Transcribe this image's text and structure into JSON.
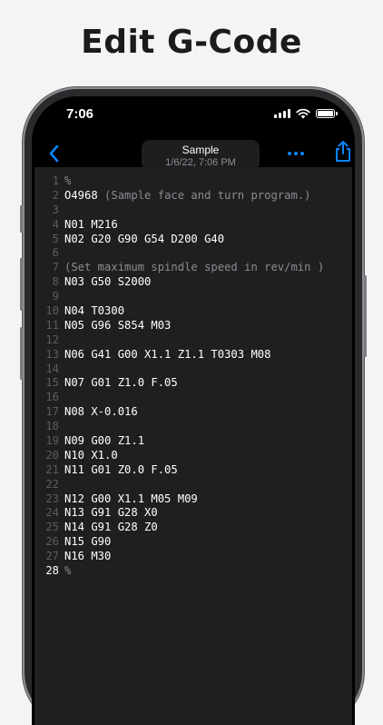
{
  "headline": "Edit G-Code",
  "status_bar": {
    "time": "7:06"
  },
  "nav": {
    "title": "Sample",
    "subtitle": "1/6/22, 7:06 PM",
    "back_icon": "chevron-left-icon",
    "more_icon": "ellipsis-icon",
    "share_icon": "share-icon"
  },
  "colors": {
    "accent": "#0a84ff",
    "editor_bg": "#1f1f21",
    "line_number": "#5d5d61",
    "comment": "#8c8c90"
  },
  "editor": {
    "current_line": 28,
    "lines": [
      {
        "num": "1",
        "code": "%",
        "comment": ""
      },
      {
        "num": "2",
        "code": "O4968 ",
        "comment": "(Sample face and turn program.)"
      },
      {
        "num": "3",
        "code": "",
        "comment": ""
      },
      {
        "num": "4",
        "code": "N01 M216",
        "comment": ""
      },
      {
        "num": "5",
        "code": "N02 G20 G90 G54 D200 G40",
        "comment": ""
      },
      {
        "num": "6",
        "code": "",
        "comment": ""
      },
      {
        "num": "7",
        "code": "",
        "comment": "(Set maximum spindle speed in rev/min )"
      },
      {
        "num": "8",
        "code": "N03 G50 S2000",
        "comment": ""
      },
      {
        "num": "9",
        "code": "",
        "comment": ""
      },
      {
        "num": "10",
        "code": "N04 T0300",
        "comment": ""
      },
      {
        "num": "11",
        "code": "N05 G96 S854 M03",
        "comment": ""
      },
      {
        "num": "12",
        "code": "",
        "comment": ""
      },
      {
        "num": "13",
        "code": "N06 G41 G00 X1.1 Z1.1 T0303 M08",
        "comment": ""
      },
      {
        "num": "14",
        "code": "",
        "comment": ""
      },
      {
        "num": "15",
        "code": "N07 G01 Z1.0 F.05",
        "comment": ""
      },
      {
        "num": "16",
        "code": "",
        "comment": ""
      },
      {
        "num": "17",
        "code": "N08 X-0.016",
        "comment": ""
      },
      {
        "num": "18",
        "code": "",
        "comment": ""
      },
      {
        "num": "19",
        "code": "N09 G00 Z1.1",
        "comment": ""
      },
      {
        "num": "20",
        "code": "N10 X1.0",
        "comment": ""
      },
      {
        "num": "21",
        "code": "N11 G01 Z0.0 F.05",
        "comment": ""
      },
      {
        "num": "22",
        "code": "",
        "comment": ""
      },
      {
        "num": "23",
        "code": "N12 G00 X1.1 M05 M09",
        "comment": ""
      },
      {
        "num": "24",
        "code": "N13 G91 G28 X0",
        "comment": ""
      },
      {
        "num": "25",
        "code": "N14 G91 G28 Z0",
        "comment": ""
      },
      {
        "num": "26",
        "code": "N15 G90",
        "comment": ""
      },
      {
        "num": "27",
        "code": "N16 M30",
        "comment": ""
      },
      {
        "num": "28",
        "code": "%",
        "comment": ""
      }
    ]
  }
}
